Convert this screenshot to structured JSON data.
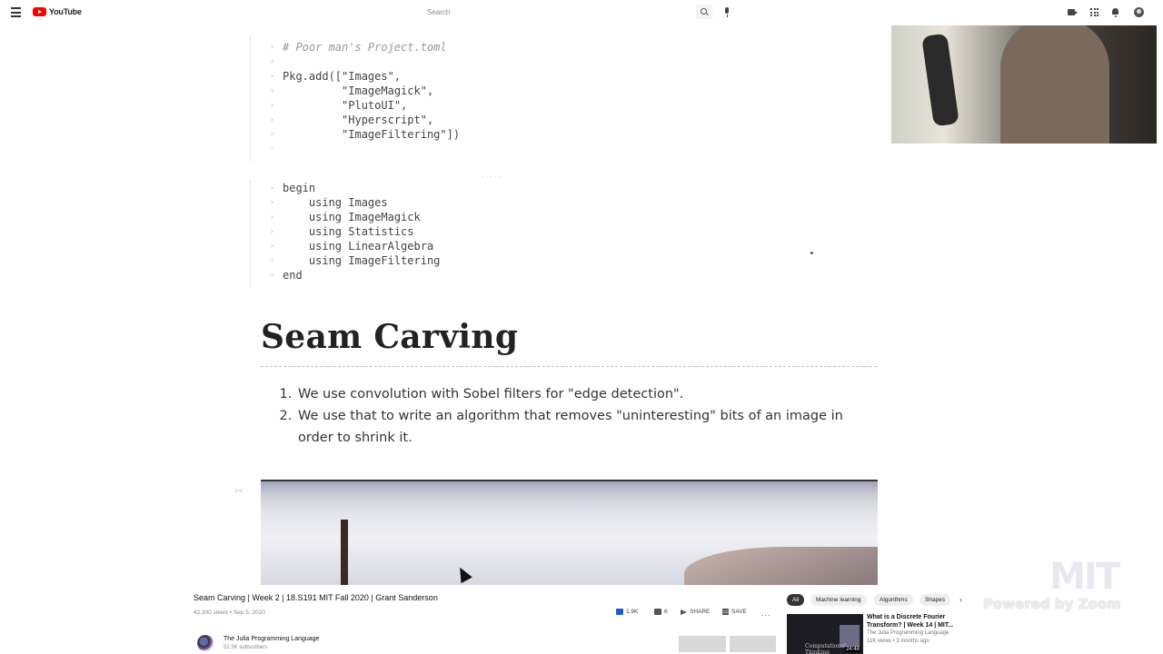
{
  "youtube": {
    "logo_text": "YouTube",
    "search_placeholder": "Search",
    "icons": [
      "menu-icon",
      "search-icon",
      "mic-icon",
      "create-video-icon",
      "apps-icon",
      "notifications-icon",
      "account-icon"
    ]
  },
  "notebook": {
    "cell1_lines": [
      "# Poor man's Project.toml",
      "",
      "Pkg.add([\"Images\",",
      "         \"ImageMagick\",",
      "         \"PlutoUI\",",
      "         \"Hyperscript\",",
      "         \"ImageFiltering\"])"
    ],
    "cell2_lines": [
      "begin",
      "    using Images",
      "    using ImageMagick",
      "    using Statistics",
      "    using LinearAlgebra",
      "    using ImageFiltering",
      "end"
    ],
    "title": "Seam Carving",
    "list": [
      "We use convolution with Sobel filters for \"edge detection\".",
      "We use that to write an algorithm that removes \"uninteresting\" bits of an image in order to shrink it."
    ]
  },
  "watermarks": {
    "mit": "MIT",
    "zoom": "Powered by Zoom"
  },
  "video": {
    "title": "Seam Carving | Week 2 | 18.S191 MIT Fall 2020 | Grant Sanderson",
    "meta": "42,300 views • Sep 5, 2020",
    "likes": "1.9K",
    "dislikes": "6",
    "share_label": "SHARE",
    "save_label": "SAVE",
    "more_label": "...",
    "channel_name": "The Julia Programming Language",
    "channel_subs": "52.5K subscribers"
  },
  "chips": [
    "All",
    "Machine learning",
    "Algorithms",
    "Shapes"
  ],
  "recommended": {
    "title": "What is a Discrete Fourier Transform? | Week 14 | MIT...",
    "channel": "The Julia Programming Language",
    "meta": "11K views • 3 months ago",
    "duration": "24:48",
    "thumb_text": "Computational Thinking"
  }
}
